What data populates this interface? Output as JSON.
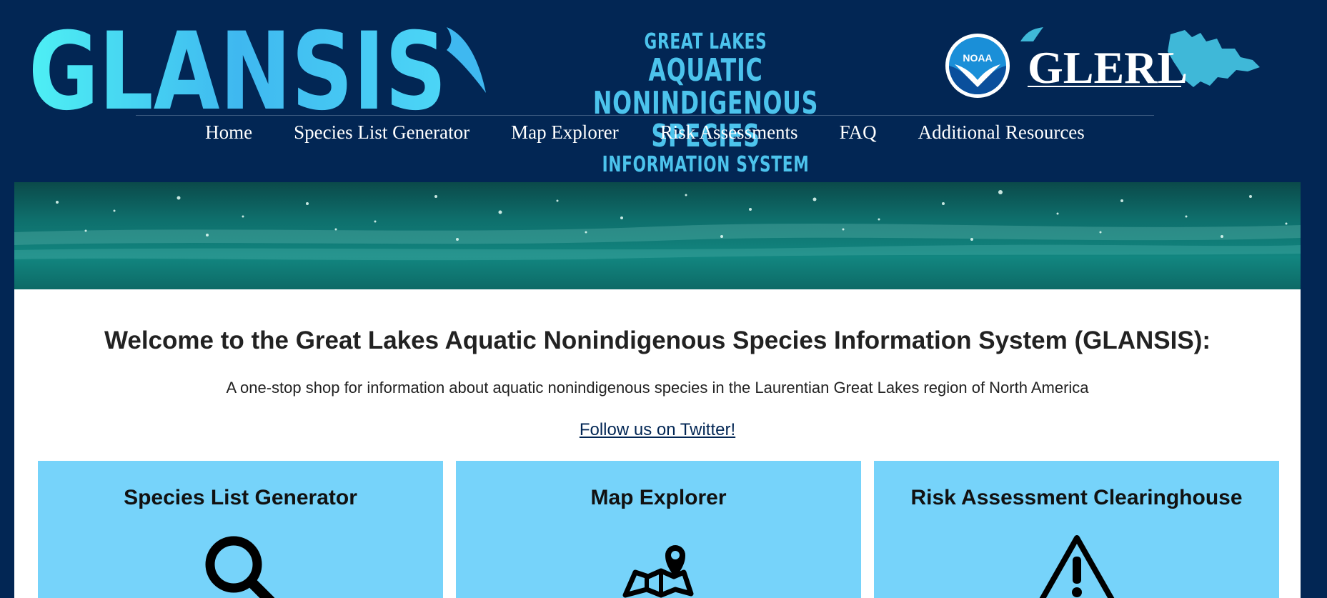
{
  "header": {
    "logo_text": "GLANSIS",
    "tagline": {
      "line1": "GREAT LAKES",
      "line2": "AQUATIC NONINDIGENOUS SPECIES",
      "line3": "INFORMATION SYSTEM"
    },
    "noaa_text": "NOAA",
    "glerl_text": "GLERL"
  },
  "nav": {
    "items": [
      {
        "label": "Home"
      },
      {
        "label": "Species List Generator"
      },
      {
        "label": "Map Explorer"
      },
      {
        "label": "Risk Assessments"
      },
      {
        "label": "FAQ"
      },
      {
        "label": "Additional Resources"
      }
    ]
  },
  "main": {
    "welcome_title": "Welcome to the Great Lakes Aquatic Nonindigenous Species Information System (GLANSIS):",
    "subtitle": "A one-stop shop for information about aquatic nonindigenous species in the Laurentian Great Lakes region of North America",
    "twitter_link": "Follow us on Twitter!",
    "cards": [
      {
        "title": "Species List Generator",
        "icon": "search-icon"
      },
      {
        "title": "Map Explorer",
        "icon": "map-pin-icon"
      },
      {
        "title": "Risk Assessment Clearinghouse",
        "icon": "warning-icon"
      }
    ]
  },
  "colors": {
    "background": "#022654",
    "logo_cyan": "#4cc3ec",
    "card_blue": "#76d3fa",
    "text_dark": "#222222"
  }
}
